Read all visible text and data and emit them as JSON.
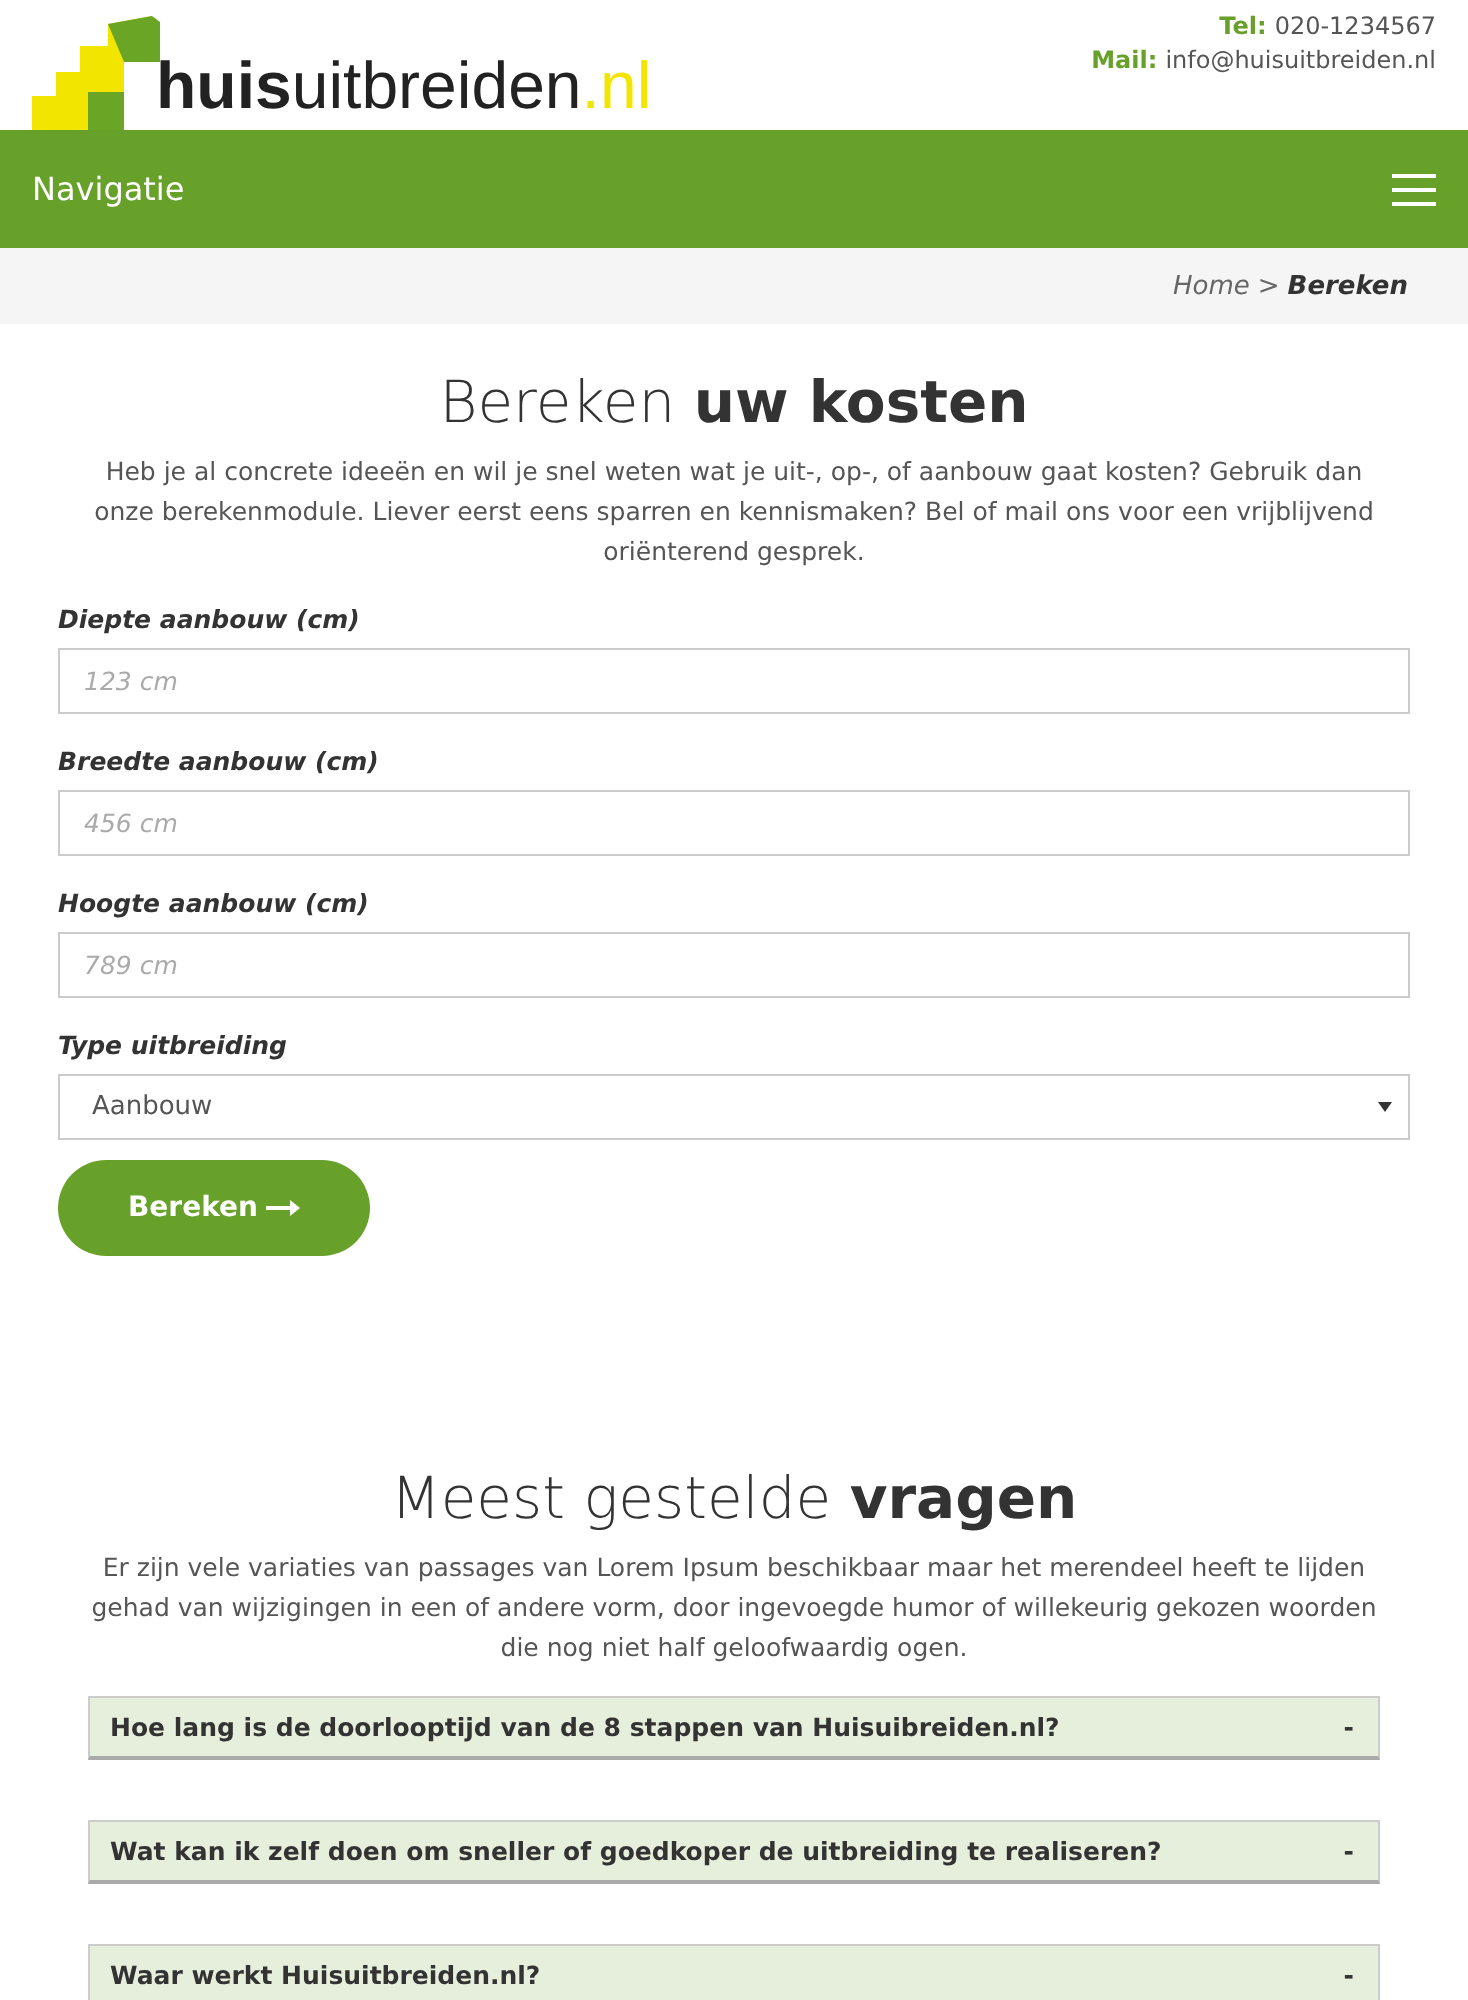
{
  "header": {
    "logo": {
      "bold": "huis",
      "regular": "uitbreiden",
      "tld": ".nl"
    },
    "contacts": [
      {
        "label": "Tel:",
        "value": "020-1234567"
      },
      {
        "label": "Mail:",
        "value": "info@huisuitbreiden.nl"
      }
    ]
  },
  "nav": {
    "title": "Navigatie"
  },
  "breadcrumb": {
    "items": [
      {
        "label": "Home",
        "current": false
      },
      {
        "label": "Bereken",
        "current": true
      }
    ],
    "separator": ">"
  },
  "calculator": {
    "title": "Bereken **uw kosten**",
    "intro": "Heb je al concrete ideeën en wil je snel weten wat je uit-, op-, of aanbouw gaat kosten? Gebruik dan onze berekenmodule. Liever eerst eens sparren en kennismaken? Bel of mail ons voor een vrijblijvend oriënterend gesprek.",
    "fields": [
      {
        "kind": "input",
        "label": "Diepte aanbouw (cm)",
        "placeholder": "123 cm"
      },
      {
        "kind": "input",
        "label": "Breedte aanbouw (cm)",
        "placeholder": "456 cm"
      },
      {
        "kind": "input",
        "label": "Hoogte aanbouw (cm)",
        "placeholder": "789 cm"
      },
      {
        "kind": "select",
        "label": "Type uitbreiding",
        "value": "Aanbouw"
      }
    ],
    "button": "Bereken"
  },
  "faq": {
    "title": "Meest gestelde **vragen**",
    "intro": "Er zijn vele variaties van passages van Lorem Ipsum beschikbaar maar het merendeel heeft te lijden gehad van wijzigingen in een of andere vorm, door ingevoegde humor of willekeurig gekozen woorden die nog niet half geloofwaardig ogen.",
    "items": [
      {
        "question": "Hoe lang is de doorlooptijd van de 8 stappen van Huisuibreiden.nl?",
        "toggle": "-"
      },
      {
        "question": "Wat kan ik zelf doen om sneller of goedkoper de uitbreiding te realiseren?",
        "toggle": "-"
      },
      {
        "question": "Waar werkt Huisuitbreiden.nl?",
        "toggle": "-"
      }
    ]
  }
}
